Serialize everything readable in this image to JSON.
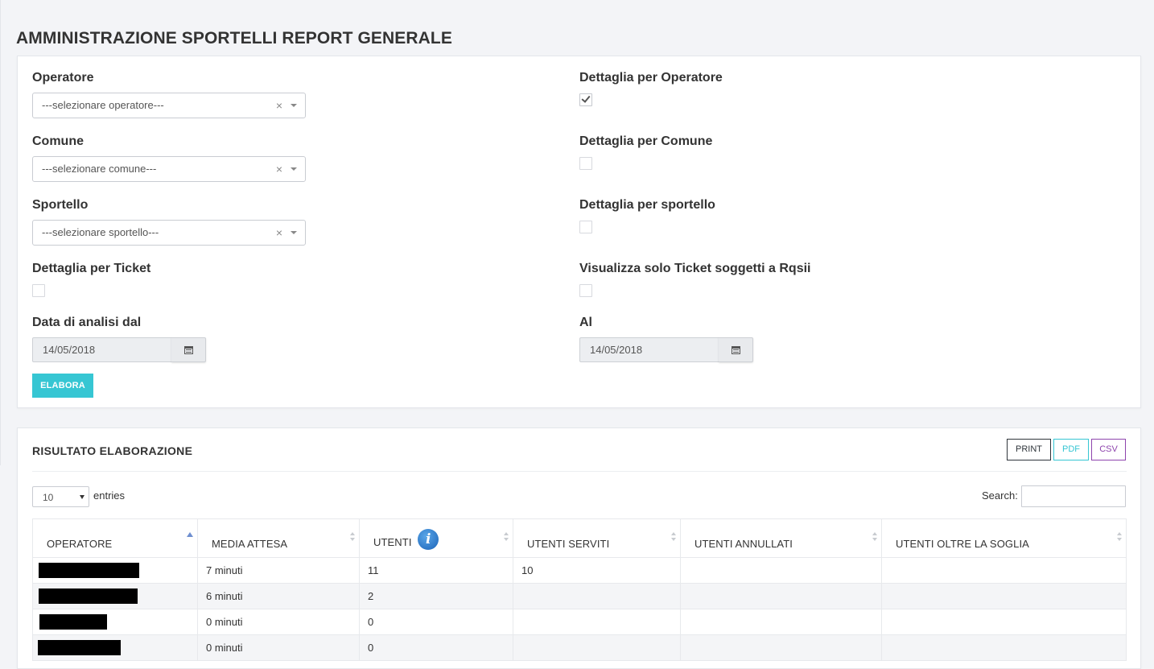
{
  "page": {
    "title": "AMMINISTRAZIONE SPORTELLI REPORT GENERALE"
  },
  "filters": {
    "operatore": {
      "label": "Operatore",
      "placeholder": "---selezionare operatore---",
      "clear": "×"
    },
    "comune": {
      "label": "Comune",
      "placeholder": "---selezionare comune---",
      "clear": "×"
    },
    "sportello": {
      "label": "Sportello",
      "placeholder": "---selezionare sportello---",
      "clear": "×"
    },
    "dettaglia_ticket": {
      "label": "Dettaglia per Ticket",
      "checked": false
    },
    "dettaglia_operatore": {
      "label": "Dettaglia per Operatore",
      "checked": true
    },
    "dettaglia_comune": {
      "label": "Dettaglia per Comune",
      "checked": false
    },
    "dettaglia_sportello": {
      "label": "Dettaglia per sportello",
      "checked": false
    },
    "solo_rqsii": {
      "label": "Visualizza solo Ticket soggetti a Rqsii",
      "checked": false
    },
    "data_dal": {
      "label": "Data di analisi dal",
      "value": "14/05/2018"
    },
    "data_al": {
      "label": "Al",
      "value": "14/05/2018"
    },
    "submit_label": "ELABORA"
  },
  "results": {
    "title": "RISULTATO ELABORAZIONE",
    "export": {
      "print": "PRINT",
      "pdf": "PDF",
      "csv": "CSV"
    },
    "length": {
      "value": "10",
      "suffix": "entries"
    },
    "search_label": "Search:",
    "columns": [
      "OPERATORE",
      "MEDIA ATTESA",
      "UTENTI",
      "UTENTI SERVITI",
      "UTENTI ANNULLATI",
      "UTENTI OLTRE LA SOGLIA"
    ],
    "info_icon": "i",
    "rows": [
      {
        "operatore": "",
        "media_attesa": "7 minuti",
        "utenti": "11",
        "serviti": "10",
        "annullati": "",
        "oltre_soglia": ""
      },
      {
        "operatore": "",
        "media_attesa": "6 minuti",
        "utenti": "2",
        "serviti": "",
        "annullati": "",
        "oltre_soglia": ""
      },
      {
        "operatore": "",
        "media_attesa": "0 minuti",
        "utenti": "0",
        "serviti": "",
        "annullati": "",
        "oltre_soglia": ""
      },
      {
        "operatore": "",
        "media_attesa": "0 minuti",
        "utenti": "0",
        "serviti": "",
        "annullati": "",
        "oltre_soglia": ""
      }
    ]
  },
  "colors": {
    "accent": "#36c6d3",
    "print_border": "#2f353b",
    "csv_border": "#8e44ad",
    "background": "#f3f4f7"
  }
}
